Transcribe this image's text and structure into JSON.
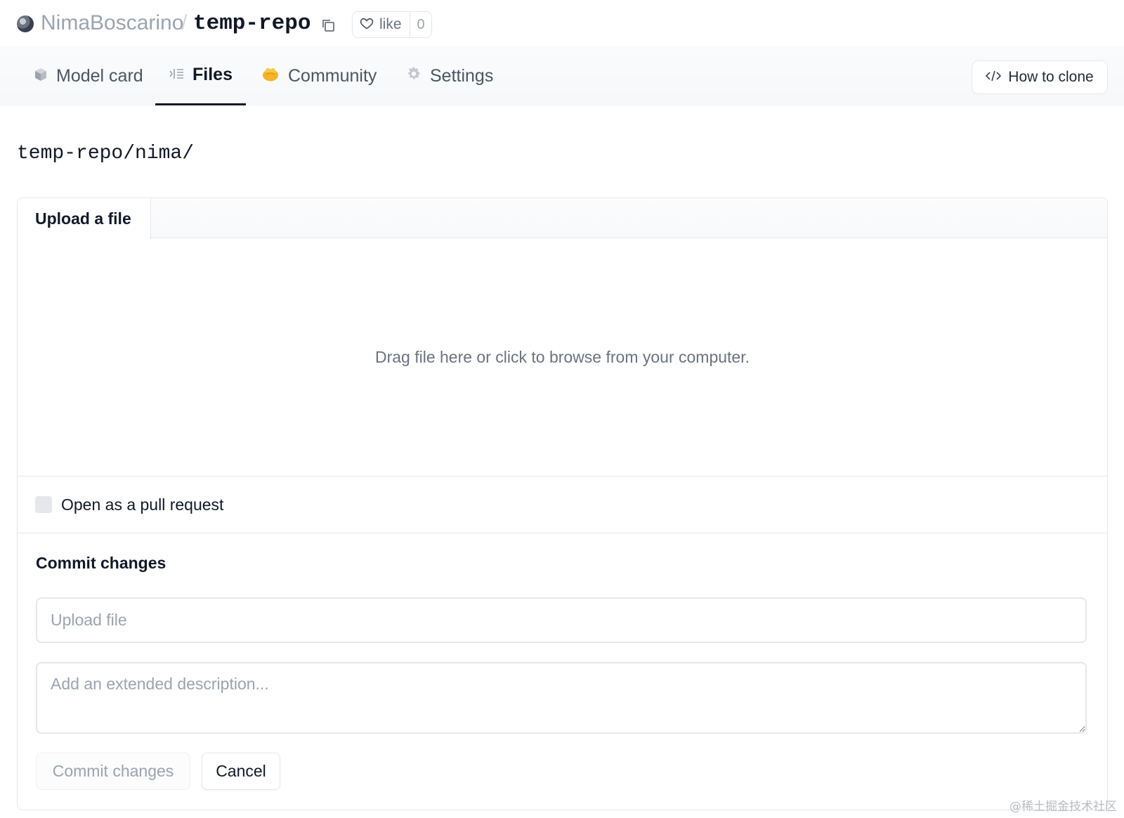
{
  "header": {
    "owner": "NimaBoscarino",
    "separator": "/",
    "repo_name": "temp-repo",
    "like_label": "like",
    "like_count": "0",
    "icons": {
      "copy": "copy-icon",
      "like": "heart-icon"
    }
  },
  "tabs": [
    {
      "label": "Model card",
      "icon": "cube-icon",
      "active": false
    },
    {
      "label": "Files",
      "icon": "files-icon",
      "active": true
    },
    {
      "label": "Community",
      "icon": "community-icon",
      "active": false
    },
    {
      "label": "Settings",
      "icon": "gear-icon",
      "active": false
    }
  ],
  "clone_button": {
    "label": "How to clone",
    "icon": "code-icon"
  },
  "path": "temp-repo/nima/",
  "upload": {
    "tab_label": "Upload a file",
    "dropzone_text": "Drag file here or click to browse from your computer.",
    "pr_label": "Open as a pull request",
    "pr_checked": false
  },
  "commit": {
    "title": "Commit changes",
    "summary_placeholder": "Upload file",
    "summary_value": "",
    "description_placeholder": "Add an extended description...",
    "description_value": "",
    "commit_button_label": "Commit changes",
    "cancel_button_label": "Cancel"
  },
  "watermark": "@稀土掘金技术社区",
  "colors": {
    "active_tab_underline": "#111827",
    "community_icon": "#f5b427",
    "muted_text": "#9ca3af"
  }
}
